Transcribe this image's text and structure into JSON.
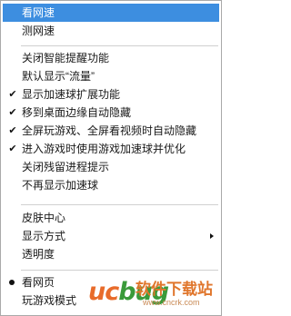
{
  "menu": {
    "items": [
      {
        "label": "看网速"
      },
      {
        "label": "测网速"
      },
      {
        "label": "关闭智能提醒功能"
      },
      {
        "label": "默认显示“流量”"
      },
      {
        "label": "显示加速球扩展功能"
      },
      {
        "label": "移到桌面边缘自动隐藏"
      },
      {
        "label": "全屏玩游戏、全屏看视频时自动隐藏"
      },
      {
        "label": "进入游戏时使用游戏加速球并优化"
      },
      {
        "label": "关闭残留进程提示"
      },
      {
        "label": "不再显示加速球"
      },
      {
        "label": "皮肤中心"
      },
      {
        "label": "显示方式"
      },
      {
        "label": "透明度"
      },
      {
        "label": "看网页"
      },
      {
        "label": "玩游戏模式"
      }
    ],
    "check_glyph": "✔",
    "highlight_color": "#3d8ee0"
  },
  "watermark": {
    "logo": "uc",
    "logo_accent": "bug",
    "text": "软件下载站",
    "url": "www.cncrk.com"
  }
}
